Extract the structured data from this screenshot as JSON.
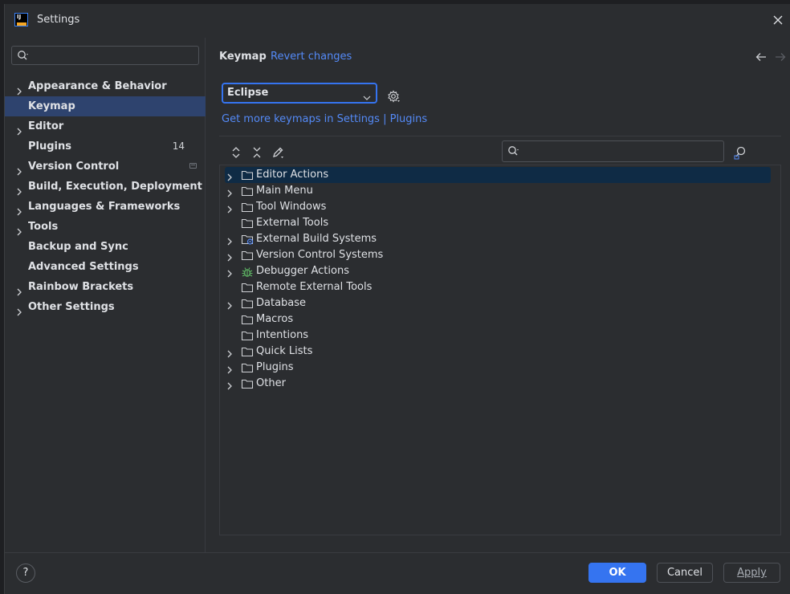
{
  "window": {
    "title": "Settings",
    "logo_text": "IJ"
  },
  "sidebar": {
    "search_placeholder": "",
    "items": [
      {
        "label": "Appearance & Behavior",
        "expandable": true
      },
      {
        "label": "Keymap",
        "expandable": false,
        "selected": true
      },
      {
        "label": "Editor",
        "expandable": true
      },
      {
        "label": "Plugins",
        "expandable": false,
        "badge": "14"
      },
      {
        "label": "Version Control",
        "expandable": true,
        "vcs_icon": true
      },
      {
        "label": "Build, Execution, Deployment",
        "expandable": true
      },
      {
        "label": "Languages & Frameworks",
        "expandable": true
      },
      {
        "label": "Tools",
        "expandable": true
      },
      {
        "label": "Backup and Sync",
        "expandable": false
      },
      {
        "label": "Advanced Settings",
        "expandable": false
      },
      {
        "label": "Rainbow Brackets",
        "expandable": true
      },
      {
        "label": "Other Settings",
        "expandable": true
      }
    ]
  },
  "main": {
    "breadcrumb": "Keymap",
    "revert_label": "Revert changes",
    "keymap_selected": "Eclipse",
    "more_link_prefix": "Get more keymaps in Settings | ",
    "more_link_plugins": "Plugins",
    "tree_search_placeholder": "",
    "tree": [
      {
        "label": "Editor Actions",
        "expandable": true,
        "selected": true,
        "icon": "folder-icon"
      },
      {
        "label": "Main Menu",
        "expandable": true,
        "icon": "folder-icon"
      },
      {
        "label": "Tool Windows",
        "expandable": true,
        "icon": "folder-icon"
      },
      {
        "label": "External Tools",
        "expandable": false,
        "icon": "folder-icon"
      },
      {
        "label": "External Build Systems",
        "expandable": true,
        "icon": "folder-build-icon"
      },
      {
        "label": "Version Control Systems",
        "expandable": true,
        "icon": "folder-icon"
      },
      {
        "label": "Debugger Actions",
        "expandable": true,
        "icon": "bug-icon"
      },
      {
        "label": "Remote External Tools",
        "expandable": false,
        "icon": "folder-icon"
      },
      {
        "label": "Database",
        "expandable": true,
        "icon": "folder-icon"
      },
      {
        "label": "Macros",
        "expandable": false,
        "icon": "folder-icon"
      },
      {
        "label": "Intentions",
        "expandable": false,
        "icon": "folder-icon"
      },
      {
        "label": "Quick Lists",
        "expandable": true,
        "icon": "folder-icon"
      },
      {
        "label": "Plugins",
        "expandable": true,
        "icon": "folder-icon"
      },
      {
        "label": "Other",
        "expandable": true,
        "icon": "folder-icon"
      }
    ]
  },
  "footer": {
    "help_label": "?",
    "ok_label": "OK",
    "cancel_label": "Cancel",
    "apply_label": "Apply"
  },
  "colors": {
    "accent": "#3574f0",
    "link": "#548af7",
    "selection_sidebar": "#2e436e",
    "selection_tree": "#0f2b45"
  }
}
